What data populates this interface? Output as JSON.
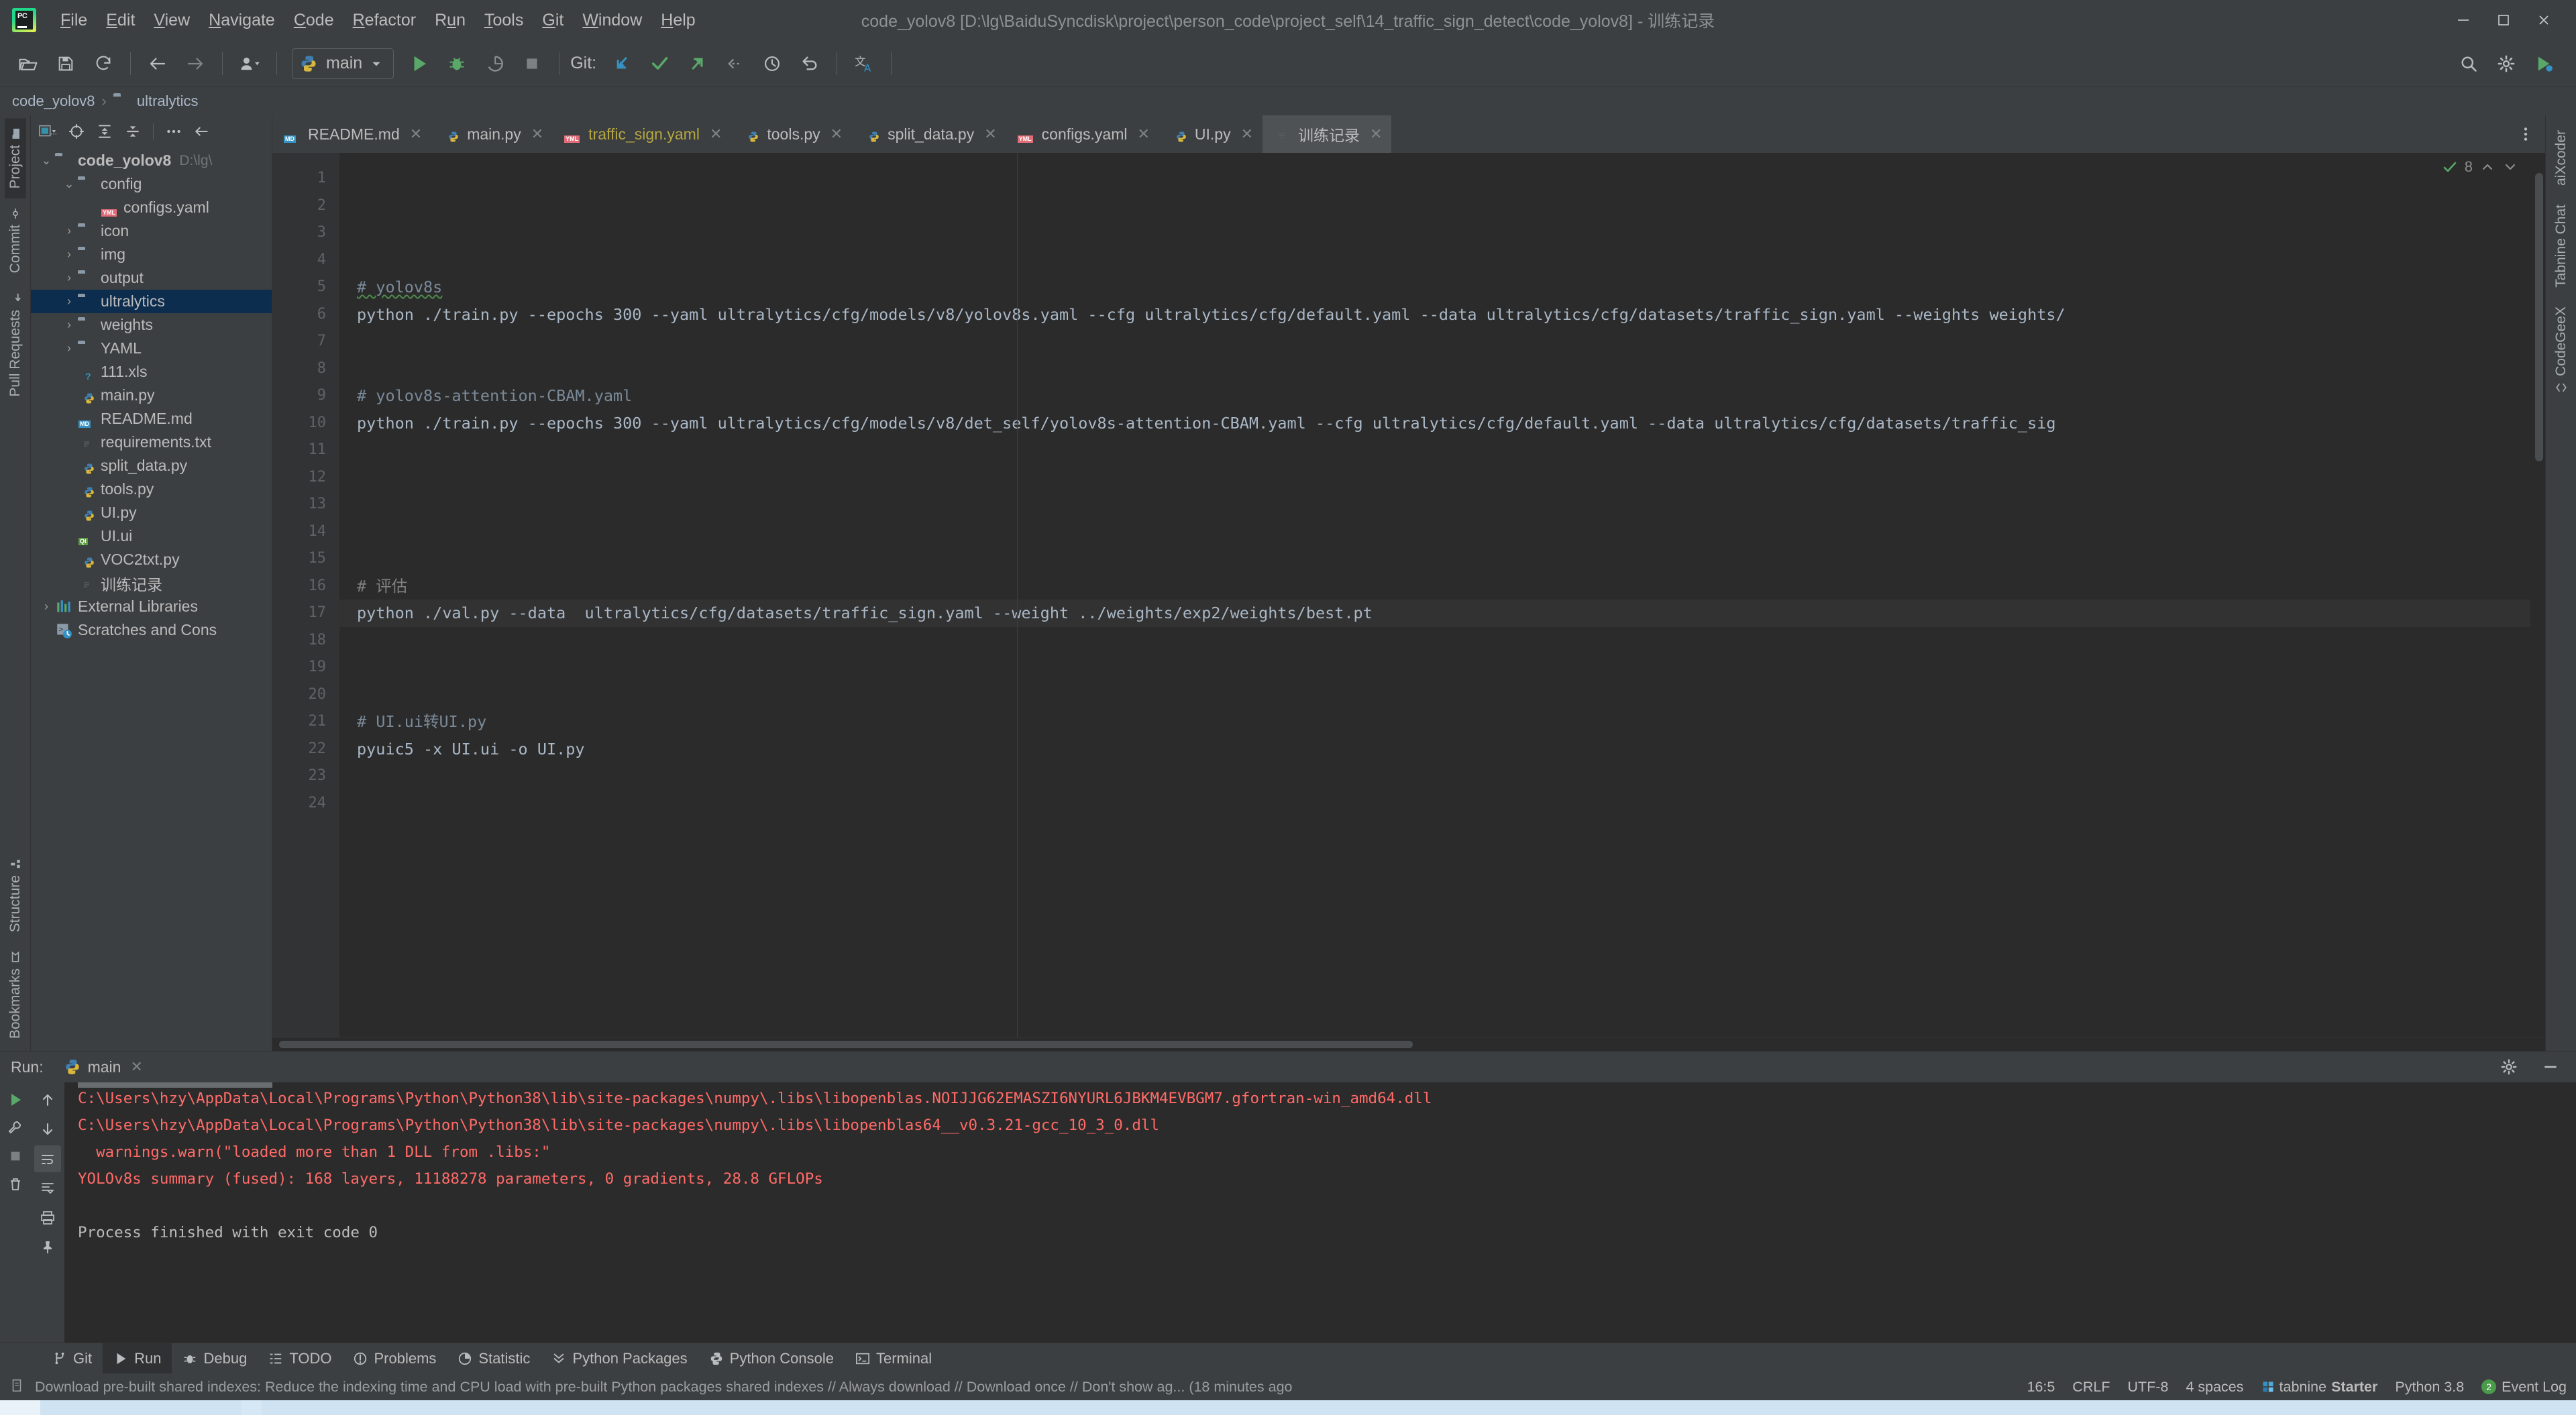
{
  "window": {
    "title": "code_yolov8 [D:\\lg\\BaiduSyncdisk\\project\\person_code\\project_self\\14_traffic_sign_detect\\code_yolov8] - 训练记录",
    "minimize": "—",
    "maximize": "☐",
    "close": "✕"
  },
  "menu": {
    "items": [
      {
        "mnemonic": "F",
        "rest": "ile"
      },
      {
        "mnemonic": "E",
        "rest": "dit"
      },
      {
        "mnemonic": "V",
        "rest": "iew"
      },
      {
        "mnemonic": "N",
        "rest": "avigate"
      },
      {
        "mnemonic": "C",
        "rest": "ode"
      },
      {
        "mnemonic": "R",
        "rest": "efactor"
      },
      {
        "mnemonic": "R",
        "rest": "un",
        "pre": "R",
        "mid": "u"
      },
      {
        "mnemonic": "T",
        "rest": "ools"
      },
      {
        "mnemonic": "G",
        "rest": "it"
      },
      {
        "mnemonic": "W",
        "rest": "indow"
      },
      {
        "mnemonic": "H",
        "rest": "elp"
      }
    ]
  },
  "toolbar": {
    "open_icon": "open-folder-icon",
    "save_icon": "save-icon",
    "sync_icon": "sync-icon",
    "back_icon": "back-arrow-icon",
    "forward_icon": "forward-arrow-icon",
    "profile_icon": "user-profile-icon",
    "run_config_name": "main",
    "run_icon": "run-icon",
    "debug_icon": "debug-icon",
    "coverage_icon": "coverage-icon",
    "stop_icon": "stop-icon",
    "git_label": "Git:",
    "git_update_icon": "git-update-icon",
    "git_commit_icon": "git-commit-icon",
    "git_push_icon": "git-push-icon",
    "git_rebase_icon": "git-rebase-icon",
    "git_history_icon": "git-history-icon",
    "git_rollback_icon": "git-rollback-icon",
    "translate_icon": "translate-icon",
    "search_icon": "search-everywhere-icon",
    "settings_icon": "settings-gear-icon",
    "updates_icon": "ide-updates-icon"
  },
  "breadcrumb": {
    "items": [
      "code_yolov8",
      "ultralytics"
    ],
    "separator": "›"
  },
  "left_rail": {
    "top": [
      {
        "label": "Project",
        "icon": "project-folder-icon",
        "active": true
      },
      {
        "label": "Commit",
        "icon": "commit-icon",
        "active": false
      },
      {
        "label": "Pull Requests",
        "icon": "pull-request-icon",
        "active": false
      }
    ],
    "bottom": [
      {
        "label": "Structure",
        "icon": "structure-icon"
      },
      {
        "label": "Bookmarks",
        "icon": "bookmark-icon"
      }
    ]
  },
  "right_rail": {
    "items": [
      {
        "label": "aiXcoder",
        "icon": "aixcoder-icon"
      },
      {
        "label": "Tabnine Chat",
        "icon": "tabnine-chat-icon"
      },
      {
        "label": "CodeGeeX",
        "icon": "codegeex-icon"
      }
    ]
  },
  "project": {
    "toolbar": {
      "scope_label": "...",
      "scope_icon": "project-scope-icon",
      "locate_icon": "locate-target-icon",
      "expand_icon": "expand-all-icon",
      "collapse_icon": "collapse-all-icon",
      "options_icon": "options-icon",
      "hide_icon": "hide-panel-icon"
    },
    "tree": [
      {
        "label": "code_yolov8",
        "path": "D:\\lg\\",
        "indent": 0,
        "twisty": "⌄",
        "icon": "folder",
        "bold": true
      },
      {
        "label": "config",
        "indent": 1,
        "twisty": "⌄",
        "icon": "folder"
      },
      {
        "label": "configs.yaml",
        "indent": 2,
        "twisty": "",
        "icon": "yml"
      },
      {
        "label": "icon",
        "indent": 1,
        "twisty": "›",
        "icon": "folder"
      },
      {
        "label": "img",
        "indent": 1,
        "twisty": "›",
        "icon": "folder"
      },
      {
        "label": "output",
        "indent": 1,
        "twisty": "›",
        "icon": "folder"
      },
      {
        "label": "ultralytics",
        "indent": 1,
        "twisty": "›",
        "icon": "folder",
        "selected": true
      },
      {
        "label": "weights",
        "indent": 1,
        "twisty": "›",
        "icon": "folder"
      },
      {
        "label": "YAML",
        "indent": 1,
        "twisty": "›",
        "icon": "folder"
      },
      {
        "label": "111.xls",
        "indent": 1,
        "twisty": "",
        "icon": "unknown"
      },
      {
        "label": "main.py",
        "indent": 1,
        "twisty": "",
        "icon": "py"
      },
      {
        "label": "README.md",
        "indent": 1,
        "twisty": "",
        "icon": "md"
      },
      {
        "label": "requirements.txt",
        "indent": 1,
        "twisty": "",
        "icon": "txt"
      },
      {
        "label": "split_data.py",
        "indent": 1,
        "twisty": "",
        "icon": "py"
      },
      {
        "label": "tools.py",
        "indent": 1,
        "twisty": "",
        "icon": "py"
      },
      {
        "label": "UI.py",
        "indent": 1,
        "twisty": "",
        "icon": "py"
      },
      {
        "label": "UI.ui",
        "indent": 1,
        "twisty": "",
        "icon": "qt"
      },
      {
        "label": "VOC2txt.py",
        "indent": 1,
        "twisty": "",
        "icon": "py"
      },
      {
        "label": "训练记录",
        "indent": 1,
        "twisty": "",
        "icon": "txt"
      },
      {
        "label": "External Libraries",
        "indent": 0,
        "twisty": "›",
        "icon": "lib"
      },
      {
        "label": "Scratches and Cons",
        "indent": 0,
        "twisty": "",
        "icon": "scratch"
      }
    ]
  },
  "editor": {
    "tabs": [
      {
        "label": "README.md",
        "icon": "md",
        "active": false
      },
      {
        "label": "main.py",
        "icon": "py",
        "active": false
      },
      {
        "label": "traffic_sign.yaml",
        "icon": "yml",
        "active": false,
        "yellow": true
      },
      {
        "label": "tools.py",
        "icon": "py",
        "active": false
      },
      {
        "label": "split_data.py",
        "icon": "py",
        "active": false
      },
      {
        "label": "configs.yaml",
        "icon": "yml",
        "active": false
      },
      {
        "label": "UI.py",
        "icon": "py",
        "active": false
      },
      {
        "label": "训练记录",
        "icon": "txt",
        "active": true
      }
    ],
    "tab_close": "✕",
    "more_tabs_icon": "more-options-icon",
    "inspection_count": "8",
    "inspection_icon": "inspection-ok-icon",
    "prev_problem_icon": "previous-problem-icon",
    "next_problem_icon": "next-problem-icon",
    "line_numbers": [
      1,
      2,
      3,
      4,
      5,
      6,
      7,
      8,
      9,
      10,
      11,
      12,
      13,
      14,
      15,
      16,
      17,
      18,
      19,
      20,
      21,
      22,
      23,
      24
    ],
    "lines": [
      {
        "n": 1,
        "text": "",
        "type": "plain"
      },
      {
        "n": 2,
        "text": "",
        "type": "plain"
      },
      {
        "n": 3,
        "text": "",
        "type": "plain"
      },
      {
        "n": 4,
        "text": "",
        "type": "plain"
      },
      {
        "n": 5,
        "text": "# yolov8s",
        "type": "comment",
        "spell": "yolov8s"
      },
      {
        "n": 6,
        "text": "python ./train.py --epochs 300 --yaml ultralytics/cfg/models/v8/yolov8s.yaml --cfg ultralytics/cfg/default.yaml --data ultralytics/cfg/datasets/traffic_sign.yaml --weights weights/",
        "type": "plain"
      },
      {
        "n": 7,
        "text": "",
        "type": "plain"
      },
      {
        "n": 8,
        "text": "",
        "type": "plain"
      },
      {
        "n": 9,
        "text": "# yolov8s-attention-CBAM.yaml",
        "type": "comment"
      },
      {
        "n": 10,
        "text": "python ./train.py --epochs 300 --yaml ultralytics/cfg/models/v8/det_self/yolov8s-attention-CBAM.yaml --cfg ultralytics/cfg/default.yaml --data ultralytics/cfg/datasets/traffic_sig",
        "type": "plain"
      },
      {
        "n": 11,
        "text": "",
        "type": "plain"
      },
      {
        "n": 12,
        "text": "",
        "type": "plain"
      },
      {
        "n": 13,
        "text": "",
        "type": "plain"
      },
      {
        "n": 14,
        "text": "",
        "type": "plain"
      },
      {
        "n": 15,
        "text": "",
        "type": "plain"
      },
      {
        "n": 16,
        "text": "# 评估",
        "type": "comment-cn"
      },
      {
        "n": 17,
        "text": "python ./val.py --data  ultralytics/cfg/datasets/traffic_sign.yaml --weight ../weights/exp2/weights/best.pt",
        "type": "plain",
        "current": true
      },
      {
        "n": 18,
        "text": "",
        "type": "plain"
      },
      {
        "n": 19,
        "text": "",
        "type": "plain"
      },
      {
        "n": 20,
        "text": "",
        "type": "plain"
      },
      {
        "n": 21,
        "text": "# UI.ui转UI.py",
        "type": "comment"
      },
      {
        "n": 22,
        "text": "pyuic5 -x UI.ui -o UI.py",
        "type": "plain"
      },
      {
        "n": 23,
        "text": "",
        "type": "plain"
      },
      {
        "n": 24,
        "text": "",
        "type": "plain"
      }
    ]
  },
  "run_panel": {
    "label": "Run:",
    "tab_name": "main",
    "tab_icon": "python-icon",
    "tab_close": "✕",
    "settings_icon": "settings-gear-icon",
    "minimize_icon": "minimize-panel-icon",
    "controls": [
      {
        "icon": "rerun-icon",
        "name": "rerun-button"
      },
      {
        "icon": "wrench-icon",
        "name": "edit-configuration-button"
      },
      {
        "icon": "stop-icon",
        "name": "stop-button"
      },
      {
        "icon": "trash-icon",
        "name": "clear-all-button"
      }
    ],
    "nav": [
      {
        "icon": "up-arrow-icon",
        "name": "previous-occurrence-button"
      },
      {
        "icon": "down-arrow-icon",
        "name": "next-occurrence-button"
      },
      {
        "icon": "soft-wrap-icon",
        "name": "soft-wrap-button"
      },
      {
        "icon": "scroll-end-icon",
        "name": "scroll-to-end-button"
      },
      {
        "icon": "print-icon",
        "name": "print-button"
      },
      {
        "icon": "pin-icon",
        "name": "pin-tab-button"
      }
    ],
    "console": [
      {
        "text": "C:\\Users\\hzy\\AppData\\Local\\Programs\\Python\\Python38\\lib\\site-packages\\numpy\\.libs\\libopenblas.NOIJJG62EMASZI6NYURL6JBKM4EVBGM7.gfortran-win_amd64.dll",
        "color": "red",
        "truncated_top": true
      },
      {
        "text": "C:\\Users\\hzy\\AppData\\Local\\Programs\\Python\\Python38\\lib\\site-packages\\numpy\\.libs\\libopenblas64__v0.3.21-gcc_10_3_0.dll",
        "color": "red"
      },
      {
        "text": "  warnings.warn(\"loaded more than 1 DLL from .libs:\"",
        "color": "red"
      },
      {
        "text": "YOLOv8s summary (fused): 168 layers, 11188278 parameters, 0 gradients, 28.8 GFLOPs",
        "color": "red"
      },
      {
        "text": "",
        "color": "red"
      },
      {
        "text": "Process finished with exit code 0",
        "color": "white"
      }
    ]
  },
  "bottom_tabs": [
    {
      "label": "Git",
      "icon": "git-branch-icon",
      "active": false
    },
    {
      "label": "Run",
      "icon": "run-icon",
      "active": true
    },
    {
      "label": "Debug",
      "icon": "debug-icon",
      "active": false
    },
    {
      "label": "TODO",
      "icon": "todo-list-icon",
      "active": false
    },
    {
      "label": "Problems",
      "icon": "problems-icon",
      "active": false
    },
    {
      "label": "Statistic",
      "icon": "statistic-icon",
      "active": false
    },
    {
      "label": "Python Packages",
      "icon": "python-packages-icon",
      "active": false
    },
    {
      "label": "Python Console",
      "icon": "python-console-icon",
      "active": false
    },
    {
      "label": "Terminal",
      "icon": "terminal-icon",
      "active": false
    }
  ],
  "status_bar": {
    "notification_icon": "notification-icon",
    "notification": "Download pre-built shared indexes: Reduce the indexing time and CPU load with pre-built Python packages shared indexes // Always download // Download once // Don't show ag... (18 minutes ago",
    "caret": "16:5",
    "line_separator": "CRLF",
    "encoding": "UTF-8",
    "indent": "4 spaces",
    "tabnine": {
      "prefix": "tabnine",
      "bold": "Starter",
      "icon": "tabnine-icon"
    },
    "interpreter": "Python 3.8",
    "event_log": {
      "count": "2",
      "label": "Event Log"
    }
  }
}
